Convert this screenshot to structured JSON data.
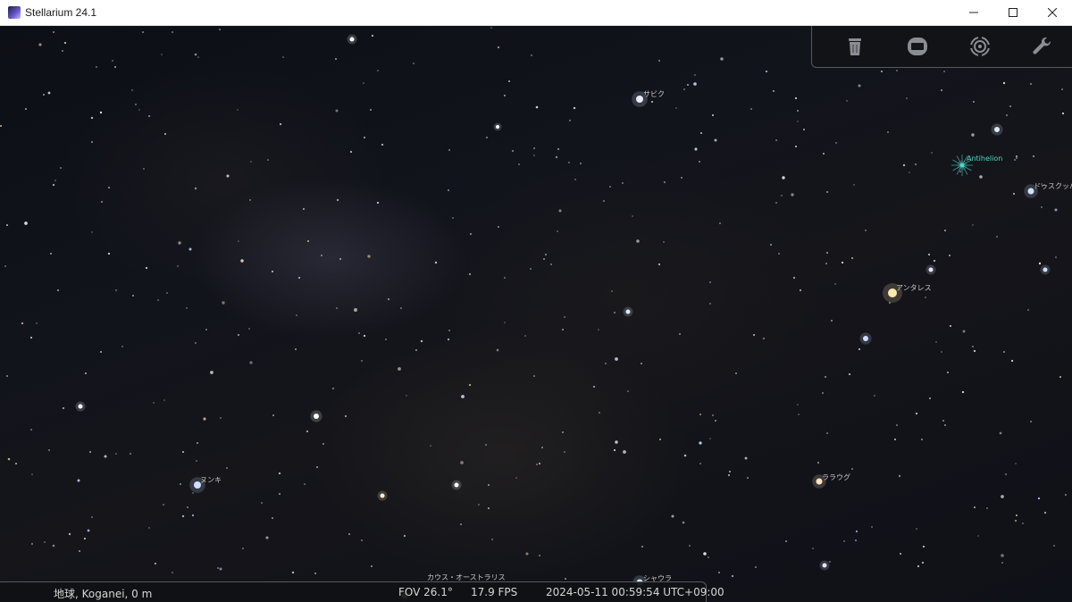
{
  "window": {
    "title": "Stellarium 24.1"
  },
  "colors": {
    "sky": "#12141c",
    "label": "#c8c8c8",
    "antihelion": "#4fd6c8",
    "bar_bg": "#121316",
    "bar_text": "#d6d6d6"
  },
  "toolbar": {
    "buttons": [
      {
        "name": "trash-can-icon"
      },
      {
        "name": "screen-icon"
      },
      {
        "name": "target-icon"
      },
      {
        "name": "wrench-icon"
      }
    ]
  },
  "labels": {
    "sabik": "サビク",
    "antihelion": "Antihelion",
    "dschubba": "ドゥスクッバ",
    "antares": "アンタレス",
    "nunki": "ヌンキ",
    "kaus": "カウス・オーストラリス",
    "lesath": "シャウラ",
    "sargas": "ララウグ"
  },
  "status": {
    "location": "地球, Koganei, 0 m",
    "fov": "FOV 26.1°",
    "fps": "17.9 FPS",
    "datetime": "2024-05-11 00:59:54 UTC+09:00"
  }
}
